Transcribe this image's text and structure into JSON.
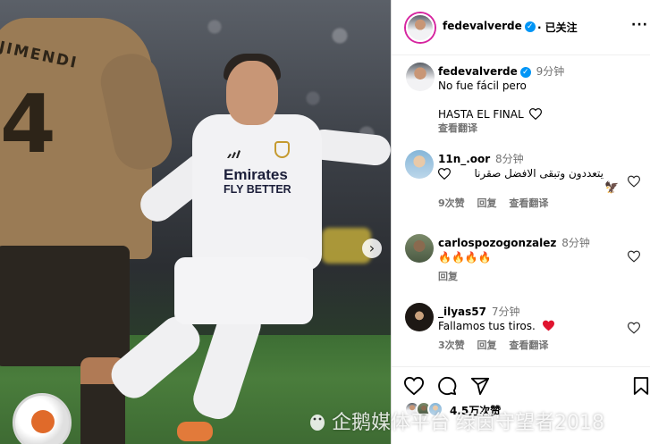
{
  "post": {
    "author": "fedevalverde",
    "follow_status": "已关注",
    "caption_line1": "No fue fácil pero",
    "caption_line2": "HASTA EL FINAL",
    "caption_time": "9分钟",
    "see_translation": "查看翻译",
    "jersey_sponsor_line1": "Emirates",
    "jersey_sponsor_line2": "FLY BETTER",
    "opponent_name": "JIMENDI",
    "opponent_number": "4"
  },
  "comments": [
    {
      "user": "11n_.oor",
      "time": "8分钟",
      "text": "يتعددون وتبقى الافضل صقرنا",
      "likes": "9次赞",
      "reply": "回复",
      "translate": "查看翻译"
    },
    {
      "user": "carlospozogonzalez",
      "time": "8分钟",
      "text": "🔥🔥🔥🔥",
      "reply": "回复"
    },
    {
      "user": "_ilyas57",
      "time": "7分钟",
      "text": "Fallamos tus tiros.",
      "likes": "3次赞",
      "reply": "回复",
      "translate": "查看翻译"
    }
  ],
  "stats": {
    "likes": "4.5万次赞"
  },
  "watermark": "企鹅媒体平台 绿茵守望者2018",
  "icons": {
    "like": "heart-icon",
    "comment": "comment-icon",
    "share": "send-icon",
    "save": "bookmark-icon",
    "next": "chevron-right-icon",
    "more": "more-icon",
    "verified": "verified-icon"
  },
  "colors": {
    "verified": "#0095f6",
    "muted": "#737373",
    "heart_red": "#ed4956"
  }
}
